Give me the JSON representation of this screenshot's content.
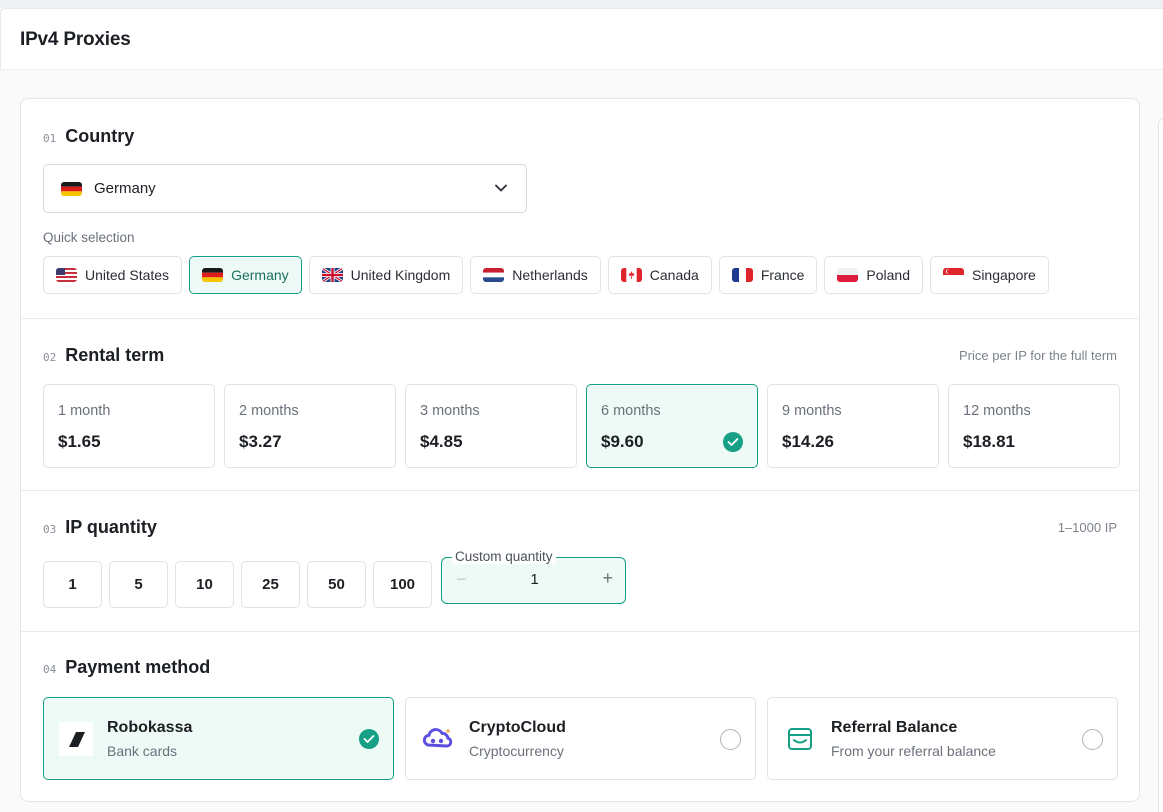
{
  "page": {
    "title": "IPv4 Proxies"
  },
  "country": {
    "num": "01",
    "title": "Country",
    "selected": "Germany",
    "selected_flag": "de",
    "quick_label": "Quick selection",
    "quick": [
      {
        "label": "United States",
        "flag": "us"
      },
      {
        "label": "Germany",
        "flag": "de"
      },
      {
        "label": "United Kingdom",
        "flag": "gb"
      },
      {
        "label": "Netherlands",
        "flag": "nl"
      },
      {
        "label": "Canada",
        "flag": "ca"
      },
      {
        "label": "France",
        "flag": "fr"
      },
      {
        "label": "Poland",
        "flag": "pl"
      },
      {
        "label": "Singapore",
        "flag": "sg"
      }
    ],
    "quick_active_index": 1
  },
  "rental": {
    "num": "02",
    "title": "Rental term",
    "hint": "Price per IP for the full term",
    "terms": [
      {
        "label": "1 month",
        "price": "$1.65"
      },
      {
        "label": "2 months",
        "price": "$3.27"
      },
      {
        "label": "3 months",
        "price": "$4.85"
      },
      {
        "label": "6 months",
        "price": "$9.60"
      },
      {
        "label": "9 months",
        "price": "$14.26"
      },
      {
        "label": "12 months",
        "price": "$18.81"
      }
    ],
    "active_index": 3
  },
  "quantity": {
    "num": "03",
    "title": "IP quantity",
    "hint": "1–1000 IP",
    "presets": [
      "1",
      "5",
      "10",
      "25",
      "50",
      "100"
    ],
    "custom_label": "Custom quantity",
    "custom_value": "1",
    "minus": "−",
    "plus": "+"
  },
  "payment": {
    "num": "04",
    "title": "Payment method",
    "methods": [
      {
        "name": "Robokassa",
        "sub": "Bank cards",
        "icon": "robokassa-icon",
        "selected": true
      },
      {
        "name": "CryptoCloud",
        "sub": "Cryptocurrency",
        "icon": "cryptocloud-icon",
        "selected": false
      },
      {
        "name": "Referral Balance",
        "sub": "From your referral balance",
        "icon": "wallet-icon",
        "selected": false
      }
    ]
  },
  "colors": {
    "accent": "#17a085",
    "accent_bg": "#eefaf6"
  }
}
